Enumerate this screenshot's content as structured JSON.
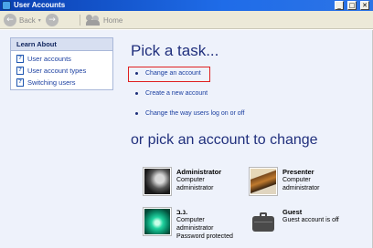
{
  "window": {
    "title": "User Accounts",
    "controls": {
      "minimize": "_",
      "maximize": "□",
      "close": "✕"
    }
  },
  "toolbar": {
    "back_label": "Back",
    "home_label": "Home"
  },
  "learn_about": {
    "heading": "Learn About",
    "items": [
      {
        "label": "User accounts"
      },
      {
        "label": "User account types"
      },
      {
        "label": "Switching users"
      }
    ]
  },
  "main": {
    "task_heading": "Pick a task...",
    "tasks": [
      {
        "label": "Change an account"
      },
      {
        "label": "Create a new account"
      },
      {
        "label": "Change the way users log on or off"
      }
    ],
    "account_heading": "or pick an account to change"
  },
  "accounts": [
    {
      "name": "Administrator",
      "lines": [
        "Computer",
        "administrator"
      ],
      "picture": "horse"
    },
    {
      "name": "Presenter",
      "lines": [
        "Computer",
        "administrator"
      ],
      "picture": "guitar"
    },
    {
      "name": "נ.ב.",
      "lines": [
        "Computer",
        "administrator",
        "Password protected"
      ],
      "picture": "green-abstract"
    },
    {
      "name": "Guest",
      "lines": [
        "Guest account is off"
      ],
      "picture": "suitcase"
    }
  ],
  "colors": {
    "heading": "#21307d",
    "link": "#1b3fa0",
    "highlight_box": "#e02020",
    "content_bg": "#eef2fb"
  }
}
